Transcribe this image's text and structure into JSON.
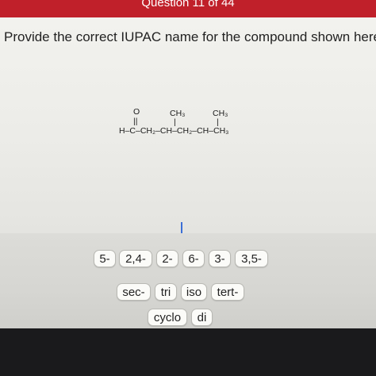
{
  "header": {
    "title": "Question 11 of 44"
  },
  "question": {
    "prompt": "Provide the correct IUPAC name for the compound shown here.",
    "structure": {
      "carbonyl_oxygen": "O",
      "double_bond": "||",
      "main_chain": "H–C–CH₂–CH–CH₂–CH–CH₃",
      "substituent_1": "CH₃",
      "substituent_2": "CH₃",
      "bond_1": "|",
      "bond_2": "|"
    }
  },
  "answer_tiles": {
    "locants": [
      "5-",
      "2,4-",
      "2-",
      "6-",
      "3-",
      "3,5-"
    ],
    "prefixes": [
      "sec-",
      "tri",
      "iso",
      "tert-"
    ],
    "more": [
      "cyclo",
      "di"
    ]
  },
  "colors": {
    "header_red": "#c0202a",
    "cursor_blue": "#3b6fd6"
  }
}
